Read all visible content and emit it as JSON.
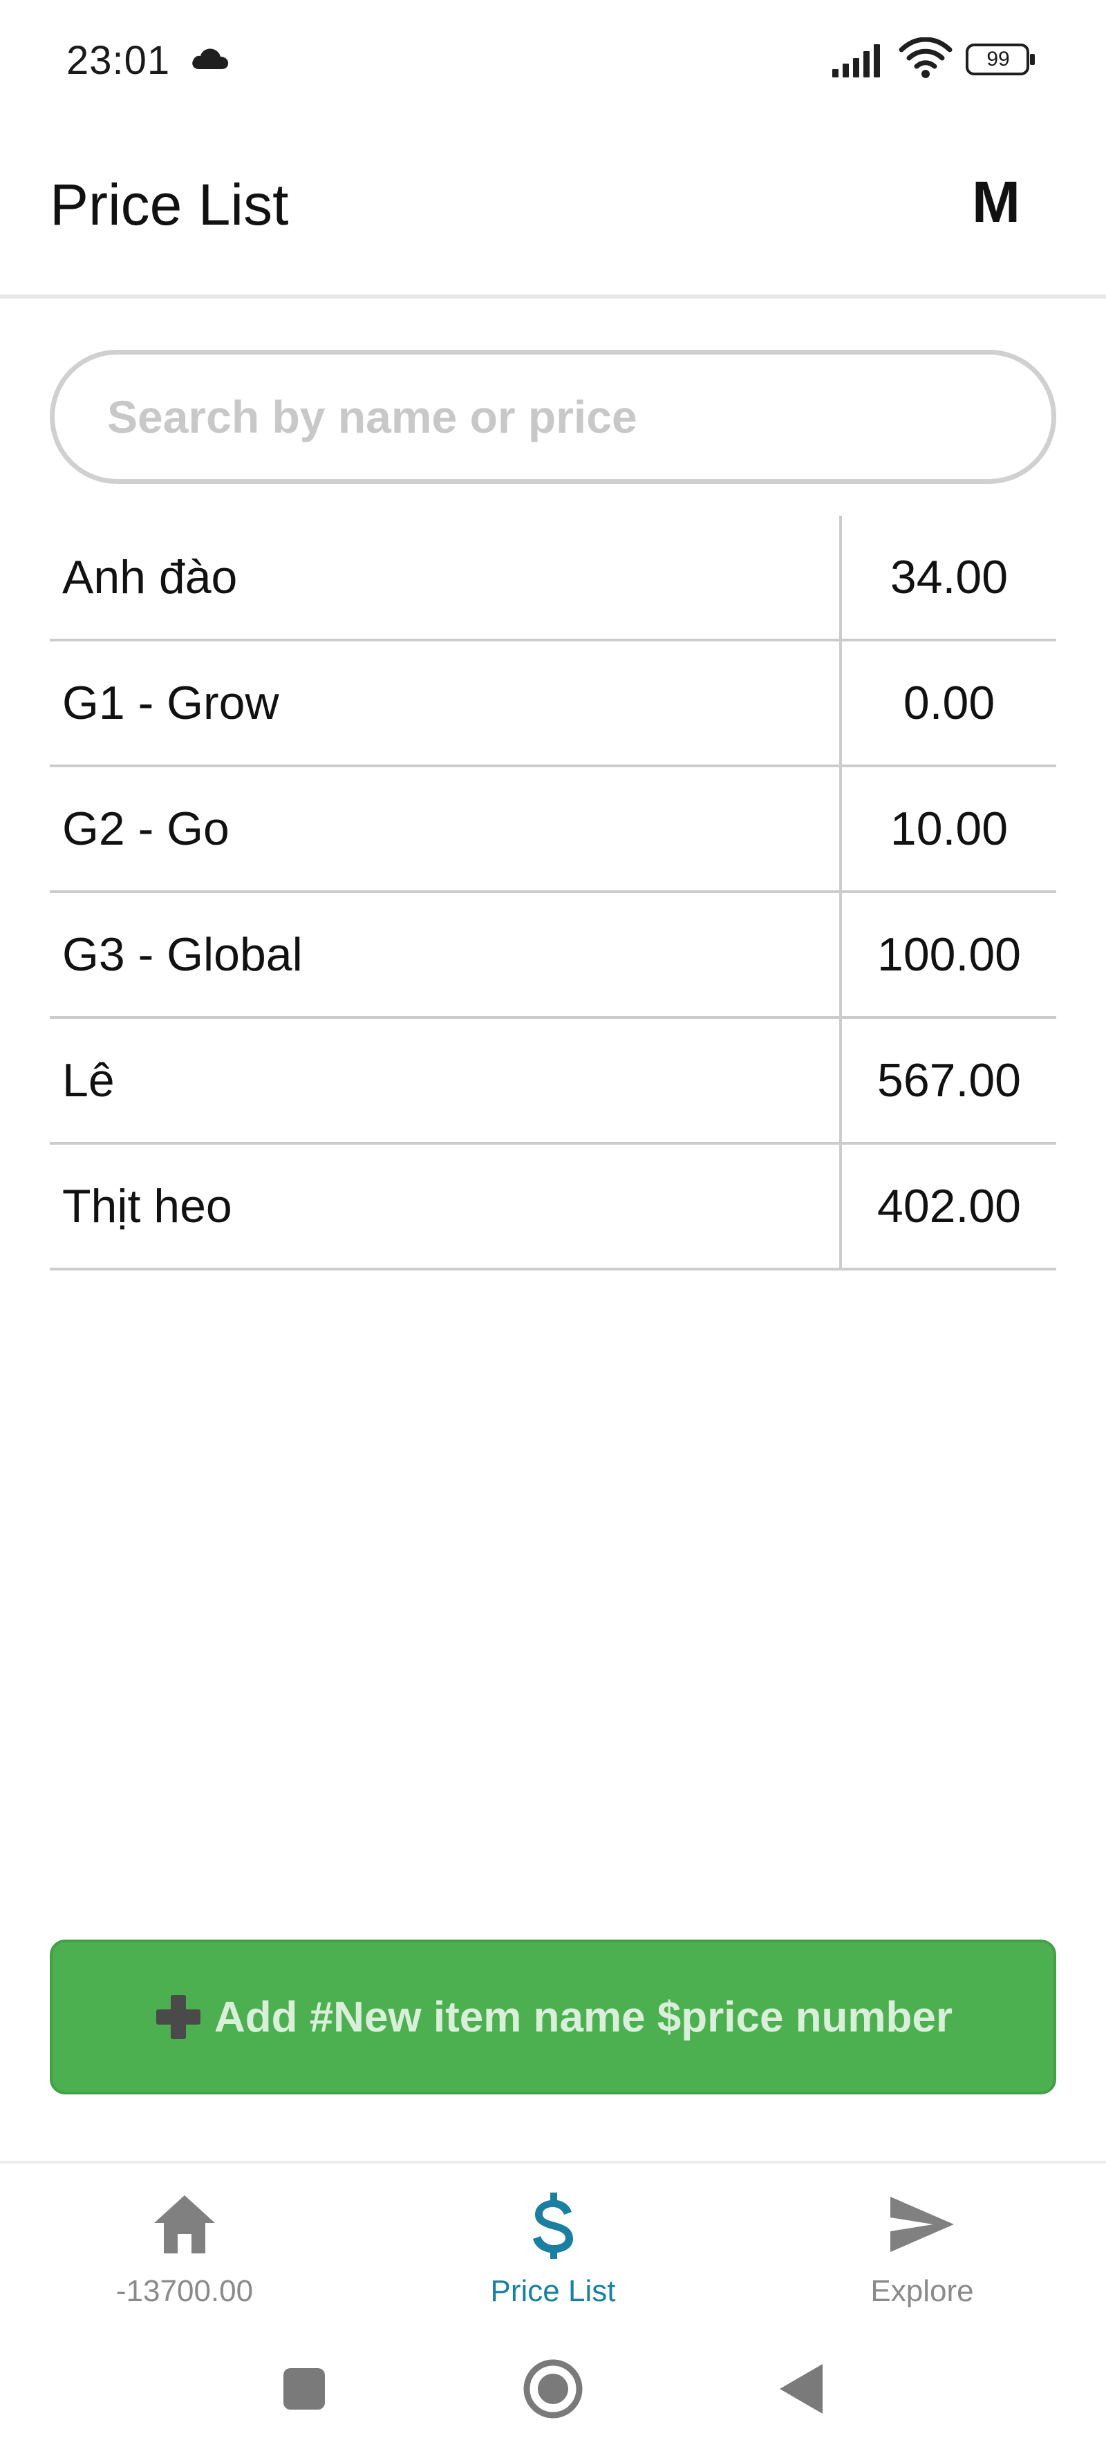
{
  "status_bar": {
    "time": "23:01",
    "battery": "99",
    "icons": [
      "cloud-icon",
      "signal-icon",
      "wifi-icon",
      "battery-icon"
    ]
  },
  "header": {
    "title": "Price List",
    "account_initial": "M"
  },
  "search": {
    "placeholder": "Search by name or price",
    "value": ""
  },
  "price_table": {
    "rows": [
      {
        "name": "Anh đào",
        "price": "34.00"
      },
      {
        "name": "G1 - Grow",
        "price": "0.00"
      },
      {
        "name": "G2 - Go",
        "price": "10.00"
      },
      {
        "name": "G3 - Global",
        "price": "100.00"
      },
      {
        "name": "Lê",
        "price": "567.00"
      },
      {
        "name": "Thịt heo",
        "price": "402.00"
      }
    ]
  },
  "add_button": {
    "label": "Add #New item name $price number",
    "icon": "plus-icon"
  },
  "bottom_nav": {
    "items": [
      {
        "label": "-13700.00",
        "icon": "home-icon",
        "active": false
      },
      {
        "label": "Price List",
        "icon": "dollar-icon",
        "active": true
      },
      {
        "label": "Explore",
        "icon": "send-icon",
        "active": false
      }
    ]
  },
  "colors": {
    "accent_green": "#4caf50",
    "active_nav": "#1a7fa0",
    "inactive_nav": "#8a8a8a",
    "divider": "#cccccc"
  },
  "system_nav": {
    "buttons": [
      "recents-button",
      "home-button",
      "back-button"
    ]
  }
}
